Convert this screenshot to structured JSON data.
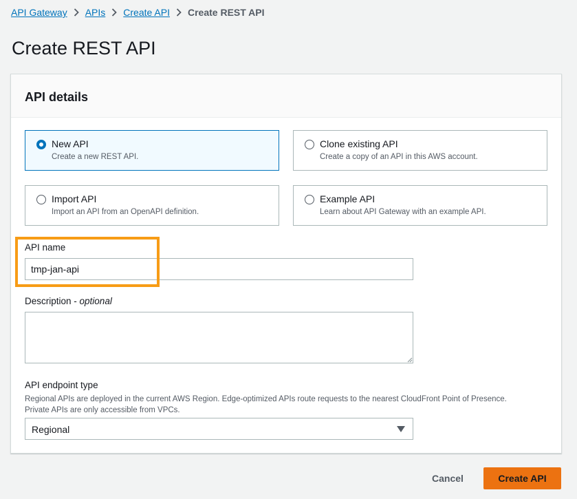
{
  "breadcrumb": {
    "items": [
      "API Gateway",
      "APIs",
      "Create API"
    ],
    "current": "Create REST API"
  },
  "page": {
    "title": "Create REST API"
  },
  "panel": {
    "title": "API details"
  },
  "options": [
    {
      "label": "New API",
      "description": "Create a new REST API.",
      "selected": true
    },
    {
      "label": "Clone existing API",
      "description": "Create a copy of an API in this AWS account.",
      "selected": false
    },
    {
      "label": "Import API",
      "description": "Import an API from an OpenAPI definition.",
      "selected": false
    },
    {
      "label": "Example API",
      "description": "Learn about API Gateway with an example API.",
      "selected": false
    }
  ],
  "form": {
    "api_name": {
      "label": "API name",
      "value": "tmp-jan-api"
    },
    "description": {
      "label": "Description",
      "optional_label": "optional",
      "value": ""
    },
    "endpoint_type": {
      "label": "API endpoint type",
      "help_line1": "Regional APIs are deployed in the current AWS Region. Edge-optimized APIs route requests to the nearest CloudFront Point of Presence.",
      "help_line2": "Private APIs are only accessible from VPCs.",
      "value": "Regional"
    }
  },
  "footer": {
    "cancel_label": "Cancel",
    "create_label": "Create API"
  },
  "colors": {
    "accent": "#0073bb",
    "primary_button": "#ec7211",
    "highlight": "#f79c16"
  }
}
